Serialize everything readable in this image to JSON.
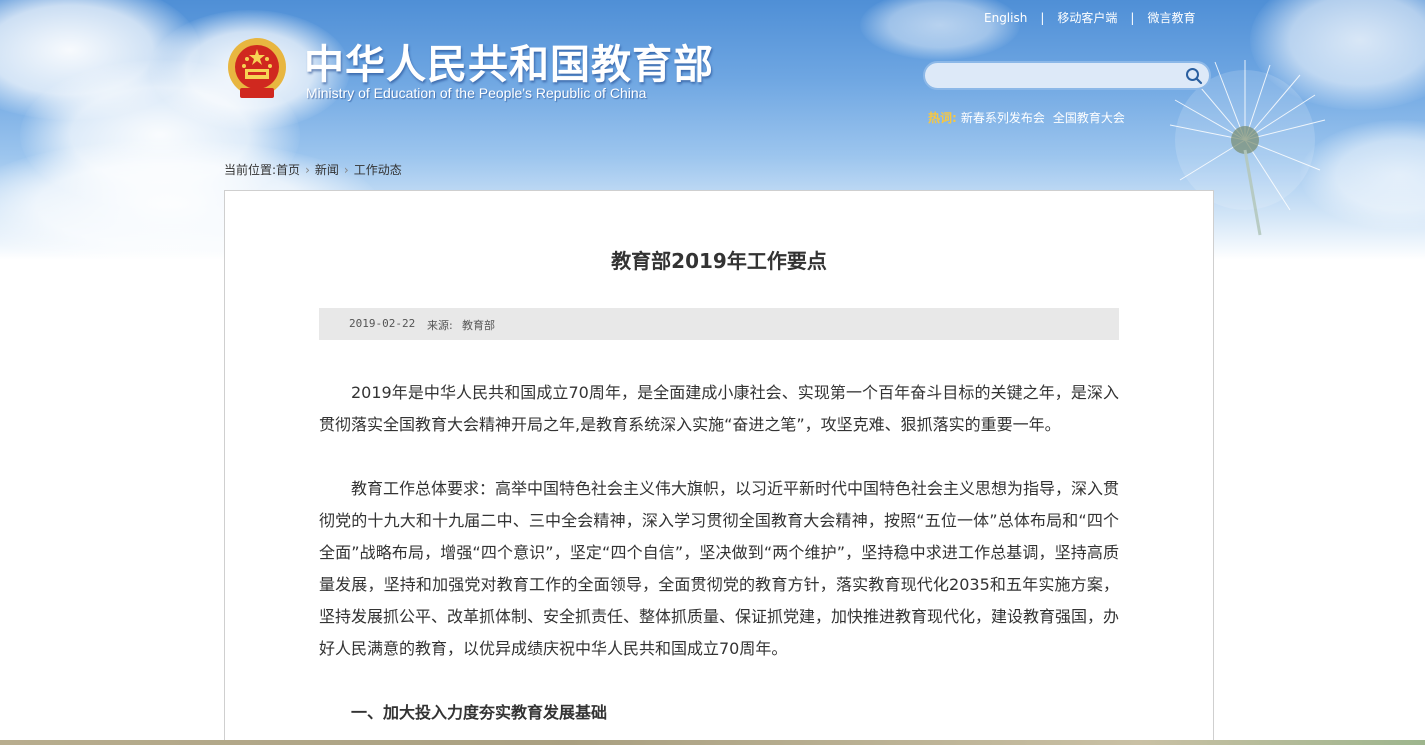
{
  "header": {
    "title_cn": "中华人民共和国教育部",
    "title_en": "Ministry of Education of the People's Republic of China",
    "top_links": [
      "English",
      "移动客户端",
      "微言教育"
    ],
    "top_links_separator": "|",
    "search": {
      "placeholder": "",
      "value": ""
    },
    "hot_words": {
      "label": "热词:",
      "items": [
        "新春系列发布会",
        "全国教育大会"
      ]
    }
  },
  "breadcrumb": {
    "label": "当前位置:",
    "items": [
      "首页",
      "新闻",
      "工作动态"
    ]
  },
  "article": {
    "title": "教育部2019年工作要点",
    "date": "2019-02-22",
    "source_label": "来源:",
    "source": "教育部",
    "paragraphs": [
      "2019年是中华人民共和国成立70周年，是全面建成小康社会、实现第一个百年奋斗目标的关键之年，是深入贯彻落实全国教育大会精神开局之年,是教育系统深入实施“奋进之笔”，攻坚克难、狠抓落实的重要一年。",
      "教育工作总体要求：高举中国特色社会主义伟大旗帜，以习近平新时代中国特色社会主义思想为指导，深入贯彻党的十九大和十九届二中、三中全会精神，深入学习贯彻全国教育大会精神，按照“五位一体”总体布局和“四个全面”战略布局，增强“四个意识”，坚定“四个自信”，坚决做到“两个维护”，坚持稳中求进工作总基调，坚持高质量发展，坚持和加强党对教育工作的全面领导，全面贯彻党的教育方针，落实教育现代化2035和五年实施方案，坚持发展抓公平、改革抓体制、安全抓责任、整体抓质量、保证抓党建，加快推进教育现代化，建设教育强国，办好人民满意的教育，以优异成绩庆祝中华人民共和国成立70周年。"
    ],
    "section_heading": "一、加大投入力度夯实教育发展基础"
  },
  "colors": {
    "hot_label": "#f6c743",
    "text": "#333333",
    "meta_bar": "#e8e8e8"
  },
  "icons": {
    "emblem": "national-emblem-icon",
    "search": "search-icon",
    "breadcrumb_arrow": "chevron-right-icon",
    "decoration": "dandelion-icon"
  }
}
